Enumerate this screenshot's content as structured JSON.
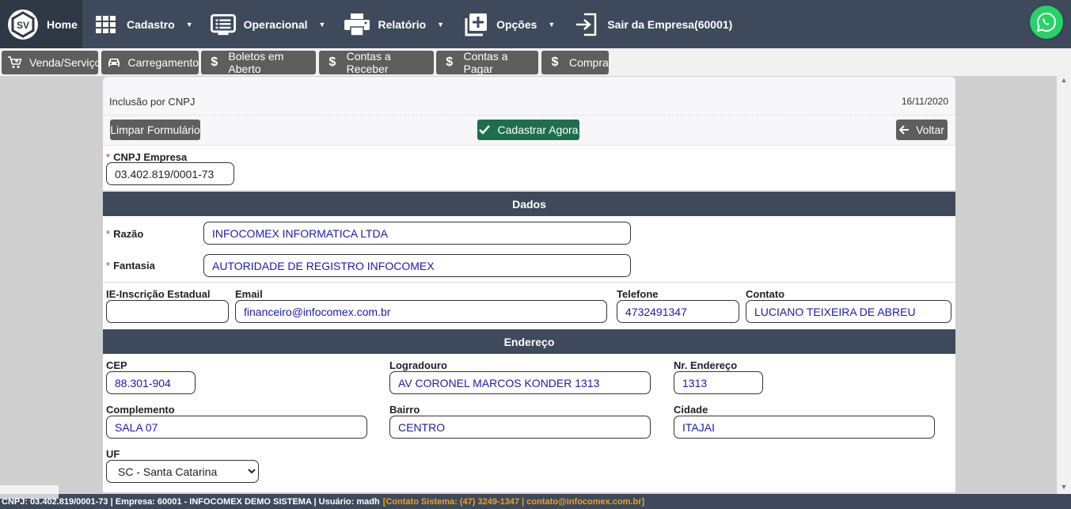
{
  "nav": {
    "logo_text": "SV",
    "home": "Home",
    "items": [
      {
        "label": "Cadastro",
        "icon": "grid-icon"
      },
      {
        "label": "Operacional",
        "icon": "list-icon"
      },
      {
        "label": "Relatório",
        "icon": "printer-icon"
      },
      {
        "label": "Opções",
        "icon": "plus-square-icon"
      },
      {
        "label": "Sair da Empresa(60001)",
        "icon": "exit-icon"
      }
    ],
    "whatsapp_icon": "whatsapp-icon"
  },
  "shortcuts": [
    {
      "label": "Venda/Serviço",
      "icon": "cart-icon"
    },
    {
      "label": "Carregamento",
      "icon": "car-icon"
    },
    {
      "label": "Boletos em Aberto",
      "icon": "dollar-icon"
    },
    {
      "label": "Contas a Receber",
      "icon": "dollar-icon"
    },
    {
      "label": "Contas a Pagar",
      "icon": "dollar-icon"
    },
    {
      "label": "Compra",
      "icon": "dollar-icon"
    }
  ],
  "panel": {
    "title": "Inclusão por CNPJ",
    "date": "16/11/2020",
    "clear_button": "Limpar Formulário",
    "submit_button": "Cadastrar Agora",
    "back_button": "Voltar"
  },
  "form": {
    "cnpj": {
      "label": "CNPJ Empresa",
      "value": "03.402.819/0001-73"
    },
    "section_dados": "Dados",
    "razao": {
      "label": "Razão",
      "value": "INFOCOMEX INFORMATICA LTDA"
    },
    "fantasia": {
      "label": "Fantasia",
      "value": "AUTORIDADE DE REGISTRO INFOCOMEX"
    },
    "ie": {
      "label": "IE-Inscrição Estadual",
      "value": ""
    },
    "email": {
      "label": "Email",
      "value": "financeiro@infocomex.com.br"
    },
    "telefone": {
      "label": "Telefone",
      "value": "4732491347"
    },
    "contato": {
      "label": "Contato",
      "value": "LUCIANO TEIXEIRA DE ABREU"
    },
    "section_endereco": "Endereço",
    "cep": {
      "label": "CEP",
      "value": "88.301-904"
    },
    "logradouro": {
      "label": "Logradouro",
      "value": "AV CORONEL MARCOS KONDER 1313"
    },
    "nr_endereco": {
      "label": "Nr. Endereço",
      "value": "1313"
    },
    "complemento": {
      "label": "Complemento",
      "value": "SALA 07"
    },
    "bairro": {
      "label": "Bairro",
      "value": "CENTRO"
    },
    "cidade": {
      "label": "Cidade",
      "value": "ITAJAI"
    },
    "uf": {
      "label": "UF",
      "value": "SC - Santa Catarina"
    }
  },
  "footer": {
    "info": "CNPJ: 03.402.819/0001-73 | Empresa: 60001 - INFOCOMEX DEMO SISTEMA | Usuário: madh",
    "contact": "[Contato Sistema: (47) 3249-1347 | contato@infocomex.com.br]"
  },
  "colors": {
    "nav_bg": "#3e4a5c",
    "submit_green": "#1e6e4e",
    "shortcut_gray": "#5e5e5e",
    "input_text_blue": "#1a1ab8",
    "footer_contact": "#f0a020"
  }
}
